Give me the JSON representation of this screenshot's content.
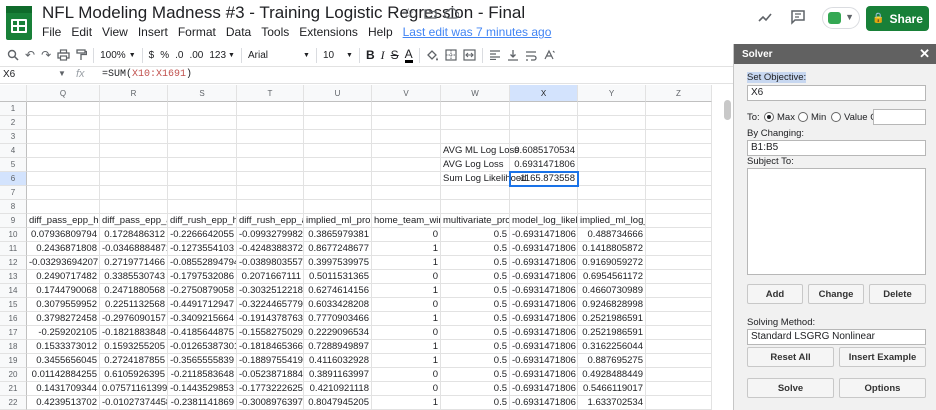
{
  "doc": {
    "title": "NFL Modeling Madness #3 - Training Logistic Regression - Final",
    "menu": [
      "File",
      "Edit",
      "View",
      "Insert",
      "Format",
      "Data",
      "Tools",
      "Extensions",
      "Help"
    ],
    "last_edit": "Last edit was 7 minutes ago",
    "share_label": "Share"
  },
  "toolbar": {
    "zoom": "100%",
    "currency": "$",
    "percent": "%",
    "dec_less": ".0",
    "dec_more": ".00",
    "format_more": "123",
    "font": "Arial",
    "font_size": "10",
    "bold": "B",
    "italic": "I",
    "strike": "S",
    "text_color": "A"
  },
  "formula_bar": {
    "cell_ref": "X6",
    "fx": "fx",
    "formula_prefix": "=SUM(",
    "formula_range": "X10:X1691",
    "formula_suffix": ")"
  },
  "columns": [
    "Q",
    "R",
    "S",
    "T",
    "U",
    "V",
    "W",
    "X",
    "Y",
    "Z"
  ],
  "row_numbers": [
    "1",
    "2",
    "3",
    "4",
    "5",
    "6",
    "7",
    "8",
    "9",
    "10",
    "11",
    "12",
    "13",
    "14",
    "15",
    "16",
    "17",
    "18",
    "19",
    "20",
    "21",
    "22"
  ],
  "summary": {
    "r4_label": "AVG ML Log Loss",
    "r4_value": "0.6085170534",
    "r5_label": "AVG Log Loss",
    "r5_value": "0.6931471806",
    "r6_label": "Sum Log Likelihood",
    "r6_value": "-1165.873558"
  },
  "headers": [
    "diff_pass_epp_home",
    "diff_pass_epp_away",
    "diff_rush_epp_home",
    "diff_rush_epp_away",
    "implied_ml_prob",
    "home_team_win",
    "multivariate_prob",
    "model_log_likelihood",
    "implied_ml_log_loss"
  ],
  "rows": [
    [
      "0.07936809794",
      "0.1728486312",
      "-0.2266642055",
      "-0.09932799824",
      "0.3865979381",
      "0",
      "0.5",
      "-0.6931471806",
      "0.488734666"
    ],
    [
      "0.2436871808",
      "-0.03468884871",
      "-0.1273554103",
      "-0.4248388372",
      "0.8677248677",
      "1",
      "0.5",
      "-0.6931471806",
      "0.1418805872"
    ],
    [
      "-0.03293694207",
      "0.2719771466",
      "-0.08552894794",
      "-0.03898035577",
      "0.3997539975",
      "1",
      "0.5",
      "-0.6931471806",
      "0.9169059272"
    ],
    [
      "0.2490717482",
      "0.3385530743",
      "-0.1797532086",
      "0.2071667111",
      "0.5011531365",
      "0",
      "0.5",
      "-0.6931471806",
      "0.6954561172"
    ],
    [
      "0.1744790068",
      "0.2471880568",
      "-0.2750879058",
      "-0.3032512218",
      "0.6274614156",
      "1",
      "0.5",
      "-0.6931471806",
      "0.4660730989"
    ],
    [
      "0.3079559952",
      "0.2251132568",
      "-0.4491712947",
      "-0.3224465779",
      "0.6033428208",
      "0",
      "0.5",
      "-0.6931471806",
      "0.9246828998"
    ],
    [
      "0.3798272458",
      "-0.2976090157",
      "-0.3409215664",
      "-0.1914378763",
      "0.7770903466",
      "1",
      "0.5",
      "-0.6931471806",
      "0.2521986591"
    ],
    [
      "-0.259202105",
      "-0.1821883848",
      "-0.4185644875",
      "-0.1558275029",
      "0.2229096534",
      "0",
      "0.5",
      "-0.6931471806",
      "0.2521986591"
    ],
    [
      "0.1533373012",
      "0.1593255205",
      "-0.01265387301",
      "-0.1818465366",
      "0.7288949897",
      "1",
      "0.5",
      "-0.6931471806",
      "0.3162256044"
    ],
    [
      "0.3455656045",
      "0.2724187855",
      "-0.3565555839",
      "-0.1889755419",
      "0.4116032928",
      "1",
      "0.5",
      "-0.6931471806",
      "0.887695275"
    ],
    [
      "0.01142884255",
      "0.6105926395",
      "-0.2118583648",
      "-0.05238718842",
      "0.3891163997",
      "0",
      "0.5",
      "-0.6931471806",
      "0.4928488449"
    ],
    [
      "0.1431709344",
      "0.07571161399",
      "-0.1443529853",
      "-0.1773222625",
      "0.4210921118",
      "0",
      "0.5",
      "-0.6931471806",
      "0.5466119017"
    ],
    [
      "0.4239513702",
      "-0.01027374458",
      "-0.2381141869",
      "-0.3008976397",
      "0.8047945205",
      "1",
      "0.5",
      "-0.6931471806",
      "1.633702534"
    ]
  ],
  "solver": {
    "title": "Solver",
    "close": "✕",
    "set_objective_label": "Set Objective:",
    "objective_cell": "X6",
    "to_label": "To:",
    "opt_max": "Max",
    "opt_min": "Min",
    "opt_value": "Value Of:",
    "value_of": "",
    "by_changing_label": "By Changing:",
    "changing_range": "B1:B5",
    "subject_to_label": "Subject To:",
    "btn_add": "Add",
    "btn_change": "Change",
    "btn_delete": "Delete",
    "solving_method_label": "Solving Method:",
    "solving_method": "Standard LSGRG Nonlinear",
    "btn_reset": "Reset All",
    "btn_insert_example": "Insert Example",
    "btn_solve": "Solve",
    "btn_options": "Options"
  },
  "colors": {
    "accent": "#1a73e8",
    "share_green": "#188038",
    "panel_header": "#616161"
  }
}
